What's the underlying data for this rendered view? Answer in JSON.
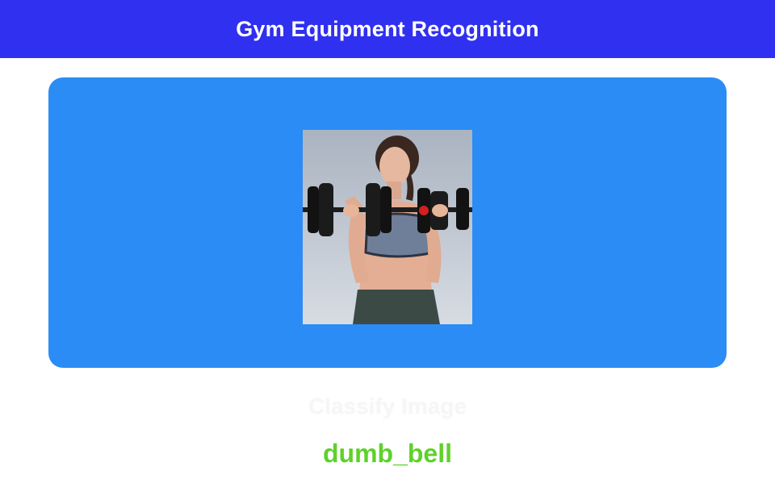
{
  "app_bar": {
    "title": "Gym Equipment Recognition",
    "background_color": "#3030f0"
  },
  "image_card": {
    "background_color": "#2b8cf5",
    "photo_description_icon": "woman-lifting-dumbbells-photo"
  },
  "classify_button": {
    "label": "Classify Image"
  },
  "result": {
    "label": "dumb_bell",
    "color": "#5ed12a"
  }
}
